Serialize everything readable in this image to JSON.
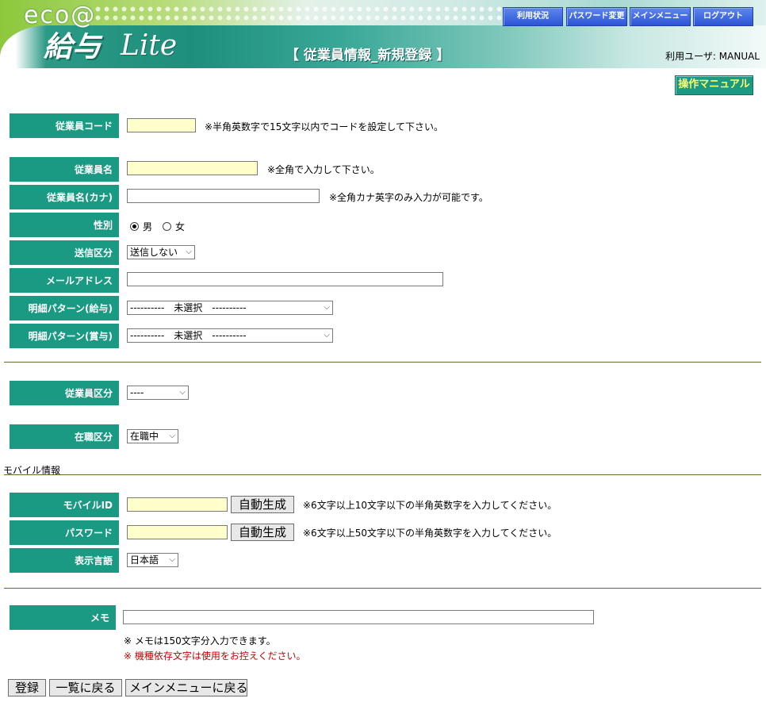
{
  "header": {
    "logo_eco": "eco@",
    "logo_kyuyo": "給与",
    "logo_lite": "Lite",
    "title": "【 従業員情報_新規登録 】",
    "user": "利用ユーザ: MANUAL",
    "nav": [
      "利用状況",
      "パスワード変更",
      "メインメニュー",
      "ログアウト"
    ]
  },
  "manual_button": "操作マニュアル",
  "form": {
    "employee_code": {
      "label": "従業員コード",
      "value": "",
      "note": "※半角英数字で15文字以内でコードを設定して下さい。"
    },
    "employee_name": {
      "label": "従業員名",
      "value": "",
      "note": "※全角で入力して下さい。"
    },
    "employee_kana": {
      "label": "従業員名(カナ)",
      "value": "",
      "note": "※全角カナ英字のみ入力が可能です。"
    },
    "gender": {
      "label": "性別",
      "options": [
        "男",
        "女"
      ],
      "selected": "男"
    },
    "send_type": {
      "label": "送信区分",
      "value": "送信しない"
    },
    "email": {
      "label": "メールアドレス",
      "value": ""
    },
    "pattern_salary": {
      "label": "明細パターン(給与)",
      "value": "----------　未選択　----------"
    },
    "pattern_bonus": {
      "label": "明細パターン(賞与)",
      "value": "----------　未選択　----------"
    },
    "employee_type": {
      "label": "従業員区分",
      "value": "----"
    },
    "employment_status": {
      "label": "在職区分",
      "value": "在職中"
    }
  },
  "mobile": {
    "section_title": "モバイル情報",
    "mobile_id": {
      "label": "モバイルID",
      "value": "",
      "gen": "自動生成",
      "note": "※6文字以上10文字以下の半角英数字を入力してください。"
    },
    "password": {
      "label": "パスワード",
      "value": "",
      "gen": "自動生成",
      "note": "※6文字以上50文字以下の半角英数字を入力してください。"
    },
    "language": {
      "label": "表示言語",
      "value": "日本語"
    }
  },
  "memo": {
    "label": "メモ",
    "value": "",
    "note1": "※ メモは150文字分入力できます。",
    "note2": "※ 機種依存文字は使用をお控えください。"
  },
  "buttons": {
    "register": "登録",
    "back_list": "一覧に戻る",
    "back_menu": "メインメニューに戻る"
  },
  "colors": {
    "label_bg": "#1a9a82",
    "nav_button": "#2c55d6",
    "input_required": "#ffffcc",
    "warning_text": "#cc0000"
  }
}
